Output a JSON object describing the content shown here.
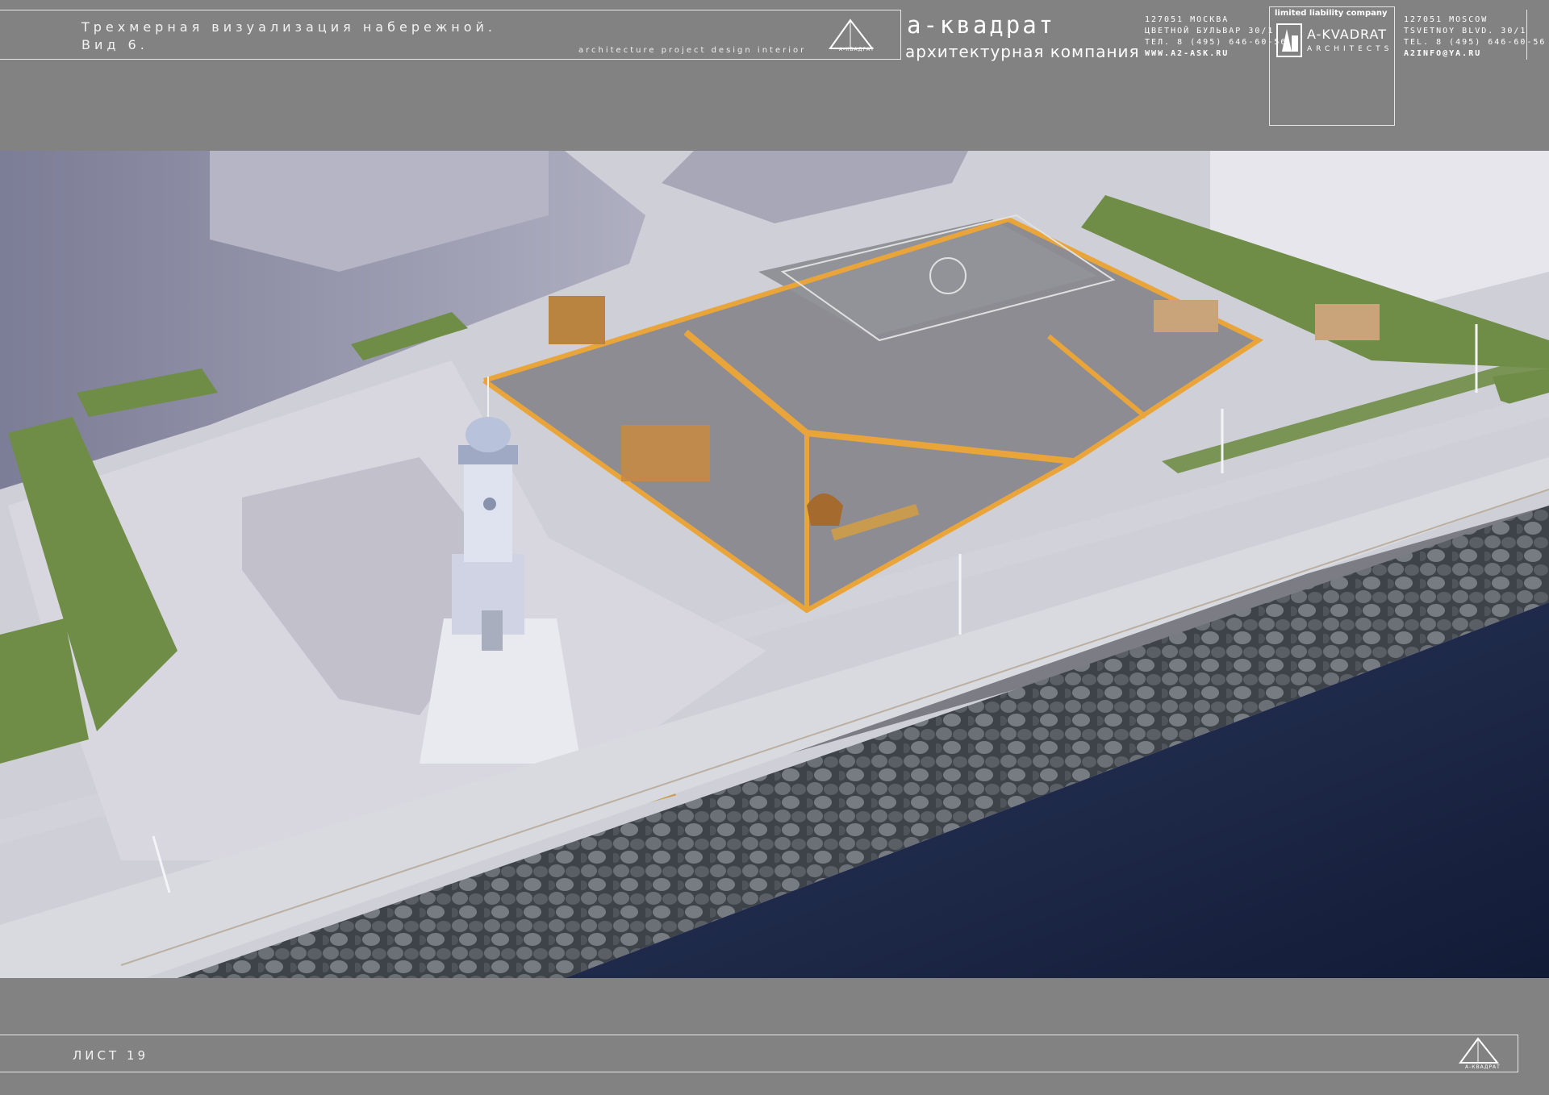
{
  "header": {
    "title_line1": "Трехмерная визуализация набережной.",
    "title_line2": "Вид 6.",
    "tagline": "architecture   project   design   interior",
    "logo_small_text": "А-КВАДРАТ",
    "brand_name": "а-квадрат",
    "brand_subtitle": "архитектурная компания",
    "address_ru": [
      "127051 МОСКВА",
      "ЦВЕТНОЙ БУЛЬВАР 30/1",
      "ТЕЛ. 8 (495) 646-60-56",
      "WWW.A2-ASK.RU"
    ],
    "llc_caption": "limited liability company",
    "llc_name": "A-KVADRAT",
    "llc_sub": "ARCHITECTS",
    "address_en": [
      "127051 MOSCOW",
      "TSVETNOY BLVD. 30/1",
      "TEL. 8 (495) 646-60-56",
      "A2INFO@YA.RU"
    ]
  },
  "footer": {
    "sheet_label": "ЛИСТ 19",
    "logo_small_text": "А-КВАДРАТ"
  },
  "colors": {
    "page_bg": "#828282",
    "frame_line": "#e6e6e6",
    "water": "#1c2a4d",
    "accent_orange": "#e9a53a",
    "grass": "#6f8d46",
    "plaza": "#d8d6df",
    "court": "#8d8c93"
  },
  "icons": {
    "header_logo": "triangle-logo-icon",
    "llc_logo": "building-logo-icon",
    "footer_logo": "triangle-logo-icon"
  }
}
